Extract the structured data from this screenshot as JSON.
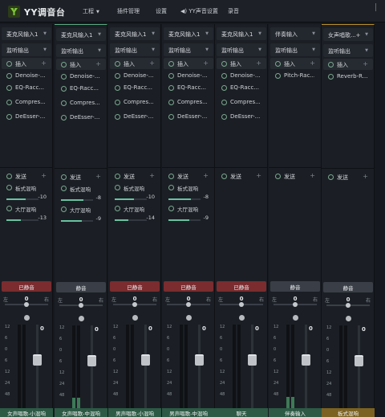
{
  "app": {
    "title": "YY调音台",
    "logo": "yy-logo"
  },
  "menu": [
    {
      "label": "工程",
      "has_caret": true
    },
    {
      "label": "插件管理",
      "has_caret": false
    },
    {
      "label": "设置",
      "has_caret": false
    },
    {
      "label": "YY声音设置",
      "has_caret": false,
      "icon": "speaker-icon"
    },
    {
      "label": "录音",
      "has_caret": false
    }
  ],
  "colors": {
    "accent": "#68c2a0",
    "mute_on": "#7a2c2f",
    "footer": "#2d5a45",
    "footer_gold": "#7c6222"
  },
  "common": {
    "insert_label": "插入",
    "send_label": "发送",
    "mute_label": "已静音",
    "unmuted_label": "静音",
    "pan_left": "左",
    "pan_right": "右",
    "pan_value": "0",
    "db_scale": [
      "12",
      "6",
      "0",
      "6",
      "12",
      "24",
      "48"
    ]
  },
  "strips": [
    {
      "input": "麦克风输入1",
      "output": "监听输出",
      "plugins": [
        "Denoise-...",
        "EQ-Racc...",
        "Compres...",
        "DeEsser-..."
      ],
      "sends": [
        {
          "name": "板式混响",
          "value": "-10",
          "level": 0.6
        },
        {
          "name": "大厅混响",
          "value": "-13",
          "level": 0.45
        }
      ],
      "muted": true,
      "volume": "0",
      "fader_level": 0.6,
      "meter_level": 0,
      "name": "女声唱歌-小混响",
      "gold": false
    },
    {
      "input": "麦克风输入1",
      "output": "监听输出",
      "plugins": [
        "Denoise-...",
        "EQ-Racc...",
        "Compres...",
        "DeEsser-..."
      ],
      "sends": [
        {
          "name": "板式混响",
          "value": "-8",
          "level": 0.7
        },
        {
          "name": "大厅混响",
          "value": "-9",
          "level": 0.65
        }
      ],
      "muted": false,
      "volume": "0",
      "fader_level": 0.6,
      "meter_level": 0.15,
      "name": "女声唱歌-中混响",
      "gold": false
    },
    {
      "input": "麦克风输入1",
      "output": "监听输出",
      "plugins": [
        "Denoise-...",
        "EQ-Racc...",
        "Compres...",
        "DeEsser-..."
      ],
      "sends": [
        {
          "name": "板式混响",
          "value": "-10",
          "level": 0.6
        },
        {
          "name": "大厅混响",
          "value": "-14",
          "level": 0.42
        }
      ],
      "muted": true,
      "volume": "0",
      "fader_level": 0.6,
      "meter_level": 0,
      "name": "男声唱歌-小混响",
      "gold": false
    },
    {
      "input": "麦克风输入1",
      "output": "监听输出",
      "plugins": [
        "Denoise-...",
        "EQ-Racc...",
        "Compres...",
        "DeEsser-..."
      ],
      "sends": [
        {
          "name": "板式混响",
          "value": "-8",
          "level": 0.7
        },
        {
          "name": "大厅混响",
          "value": "-9",
          "level": 0.65
        }
      ],
      "muted": true,
      "volume": "0",
      "fader_level": 0.6,
      "meter_level": 0,
      "name": "男声唱歌-中混响",
      "gold": false
    },
    {
      "input": "麦克风输入1",
      "output": "监听输出",
      "plugins": [
        "Denoise-...",
        "EQ-Racc...",
        "Compres...",
        "DeEsser-..."
      ],
      "sends": [],
      "muted": true,
      "volume": "0",
      "fader_level": 0.6,
      "meter_level": 0,
      "name": "聊天",
      "gold": false
    },
    {
      "input": "伴奏输入",
      "output": "监听输出",
      "plugins": [
        "Pitch-Rac..."
      ],
      "sends": [],
      "muted": false,
      "volume": "0",
      "fader_level": 0.6,
      "meter_level": 0.15,
      "name": "伴奏输入",
      "gold": false
    },
    {
      "input": "女声唱歌...+4",
      "output": "监听输出",
      "plugins": [
        "Reverb-R..."
      ],
      "sends": [],
      "muted": false,
      "volume": "0",
      "fader_level": 0.6,
      "meter_level": 0,
      "name": "板式混响",
      "gold": true
    }
  ]
}
